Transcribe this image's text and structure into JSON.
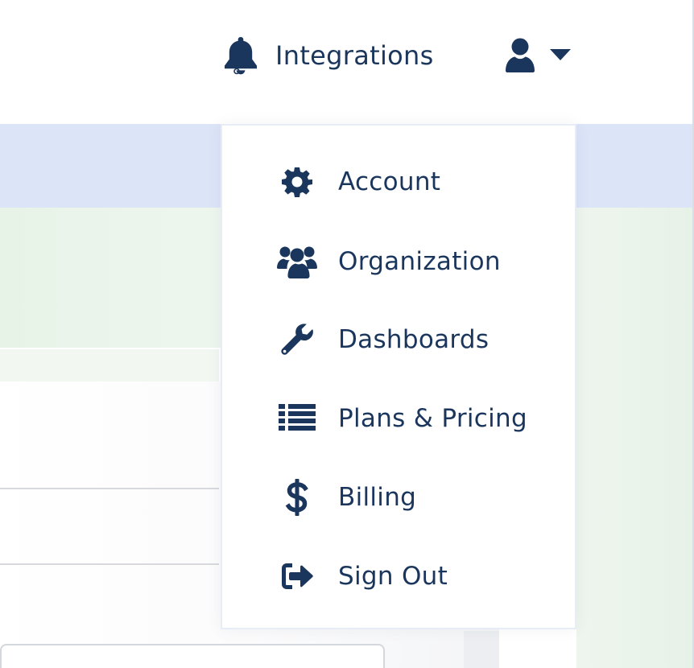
{
  "header": {
    "integrations": {
      "label": "Integrations",
      "icon": "bell-icon"
    },
    "user_menu": {
      "icon": "user-icon",
      "caret_icon": "caret-down-icon"
    }
  },
  "dropdown": {
    "items": [
      {
        "label": "Account",
        "icon": "gear-icon"
      },
      {
        "label": "Organization",
        "icon": "users-icon"
      },
      {
        "label": "Dashboards",
        "icon": "wrench-icon"
      },
      {
        "label": "Plans & Pricing",
        "icon": "list-icon"
      },
      {
        "label": "Billing",
        "icon": "dollar-icon"
      },
      {
        "label": "Sign Out",
        "icon": "sign-out-icon"
      }
    ]
  },
  "colors": {
    "text": "#1b365d",
    "band_blue": "#dce4f8",
    "band_green": "#e8f3e8"
  }
}
